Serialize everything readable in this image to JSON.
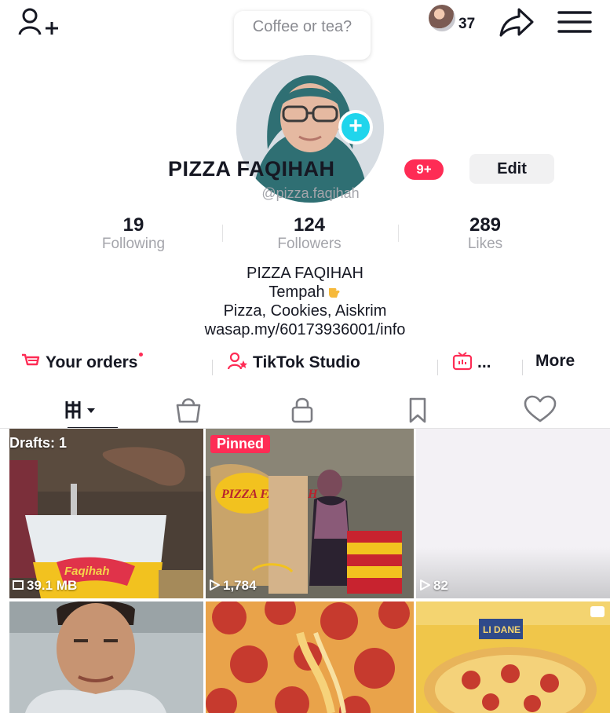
{
  "header": {
    "speech_bubble": "Coffee or tea?",
    "visitor_count": "37"
  },
  "profile": {
    "display_name": "PIZZA FAQIHAH",
    "notification_badge": "9+",
    "edit_label": "Edit",
    "handle": "@pizza.faqihah"
  },
  "stats": [
    {
      "value": "19",
      "label": "Following"
    },
    {
      "value": "124",
      "label": "Followers"
    },
    {
      "value": "289",
      "label": "Likes"
    }
  ],
  "bio": {
    "line1": "PIZZA FAQIHAH",
    "line2": "Tempah",
    "line3": "Pizza, Cookies, Aiskrim",
    "line4": "wasap.my/60173936001/info"
  },
  "shortcuts": {
    "orders": "Your orders",
    "studio": "TikTok Studio",
    "ellipsis": "...",
    "more": "More"
  },
  "videos": [
    {
      "overlay": "Drafts: 1",
      "stat": "39.1 MB",
      "caption": "Faqihah"
    },
    {
      "overlay": "Pinned",
      "stat": "1,784",
      "caption": "PIZZA FAQIHAH"
    },
    {
      "stat": "82"
    },
    {},
    {},
    {
      "sign": "LI DANE"
    }
  ],
  "colors": {
    "brand_red": "#fe2c55",
    "accent_cyan": "#20d5ec",
    "text": "#161823",
    "muted": "#a4a5ab"
  },
  "icons": [
    "add-user-icon",
    "share-icon",
    "menu-icon",
    "videos-grid-icon",
    "shop-bag-icon",
    "lock-icon",
    "bookmark-icon",
    "heart-icon",
    "cart-icon",
    "studio-icon",
    "live-icon",
    "plus-icon",
    "play-icon",
    "pointing-hand-icon"
  ]
}
